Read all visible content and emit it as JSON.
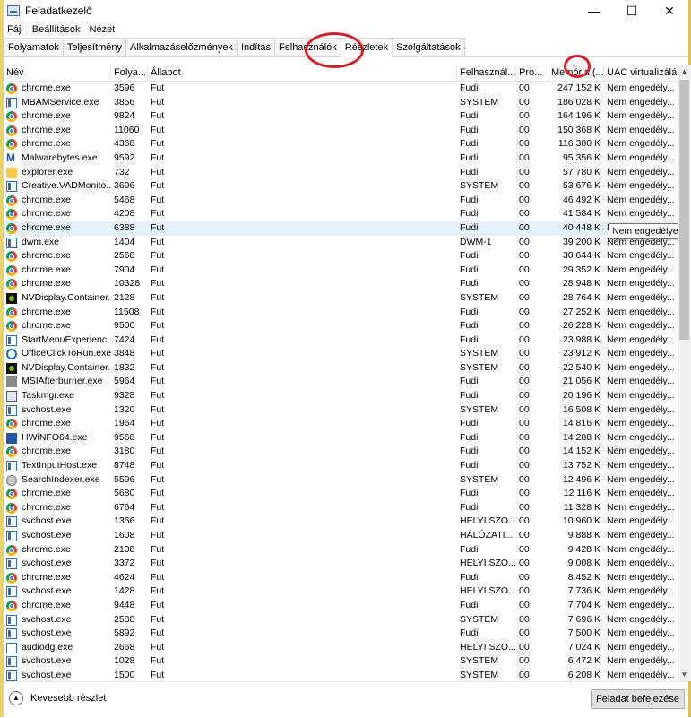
{
  "window": {
    "title": "Feladatkezelő",
    "minimize": "—",
    "maximize": "☐",
    "close": "✕"
  },
  "menu": [
    "Fájl",
    "Beállítások",
    "Nézet"
  ],
  "tabs": [
    "Folyamatok",
    "Teljesítmény",
    "Alkalmazáselőzmények",
    "Indítás",
    "Felhasználók",
    "Részletek",
    "Szolgáltatások"
  ],
  "active_tab": "Részletek",
  "columns": [
    "Név",
    "Folya...",
    "Állapot",
    "Felhasznál...",
    "Pro...",
    "Memória (...",
    "UAC virtualizálás"
  ],
  "sort_indicator": "⌄",
  "rows": [
    {
      "icon": "chrome-icon",
      "name": "chrome.exe",
      "pid": "3596",
      "status": "Fut",
      "user": "Fudi",
      "cpu": "00",
      "mem": "247 152 K",
      "uac": "Nem engedély..."
    },
    {
      "icon": "service-icon",
      "name": "MBAMService.exe",
      "pid": "3856",
      "status": "Fut",
      "user": "SYSTEM",
      "cpu": "00",
      "mem": "186 028 K",
      "uac": "Nem engedély..."
    },
    {
      "icon": "chrome-icon",
      "name": "chrome.exe",
      "pid": "9824",
      "status": "Fut",
      "user": "Fudi",
      "cpu": "00",
      "mem": "164 196 K",
      "uac": "Nem engedély..."
    },
    {
      "icon": "chrome-icon",
      "name": "chrome.exe",
      "pid": "11060",
      "status": "Fut",
      "user": "Fudi",
      "cpu": "00",
      "mem": "150 368 K",
      "uac": "Nem engedély..."
    },
    {
      "icon": "chrome-icon",
      "name": "chrome.exe",
      "pid": "4368",
      "status": "Fut",
      "user": "Fudi",
      "cpu": "00",
      "mem": "116 380 K",
      "uac": "Nem engedély..."
    },
    {
      "icon": "malwarebytes-icon",
      "name": "Malwarebytes.exe",
      "pid": "9592",
      "status": "Fut",
      "user": "Fudi",
      "cpu": "00",
      "mem": "95 356 K",
      "uac": "Nem engedély..."
    },
    {
      "icon": "folder-icon",
      "name": "explorer.exe",
      "pid": "732",
      "status": "Fut",
      "user": "Fudi",
      "cpu": "00",
      "mem": "57 780 K",
      "uac": "Nem engedély..."
    },
    {
      "icon": "service-icon",
      "name": "Creative.VADMonito...",
      "pid": "3696",
      "status": "Fut",
      "user": "SYSTEM",
      "cpu": "00",
      "mem": "53 676 K",
      "uac": "Nem engedély..."
    },
    {
      "icon": "chrome-icon",
      "name": "chrome.exe",
      "pid": "5468",
      "status": "Fut",
      "user": "Fudi",
      "cpu": "00",
      "mem": "46 492 K",
      "uac": "Nem engedély..."
    },
    {
      "icon": "chrome-icon",
      "name": "chrome.exe",
      "pid": "4208",
      "status": "Fut",
      "user": "Fudi",
      "cpu": "00",
      "mem": "41 584 K",
      "uac": "Nem engedély..."
    },
    {
      "icon": "chrome-icon",
      "name": "chrome.exe",
      "pid": "6388",
      "status": "Fut",
      "user": "Fudi",
      "cpu": "00",
      "mem": "40 448 K",
      "uac": "Nem engedély...",
      "selected": true
    },
    {
      "icon": "service-icon",
      "name": "dwm.exe",
      "pid": "1404",
      "status": "Fut",
      "user": "DWM-1",
      "cpu": "00",
      "mem": "39 200 K",
      "uac": "Nem engedély..."
    },
    {
      "icon": "chrome-icon",
      "name": "chrome.exe",
      "pid": "2568",
      "status": "Fut",
      "user": "Fudi",
      "cpu": "00",
      "mem": "30 644 K",
      "uac": "Nem engedély..."
    },
    {
      "icon": "chrome-icon",
      "name": "chrome.exe",
      "pid": "7904",
      "status": "Fut",
      "user": "Fudi",
      "cpu": "00",
      "mem": "29 352 K",
      "uac": "Nem engedély..."
    },
    {
      "icon": "chrome-icon",
      "name": "chrome.exe",
      "pid": "10328",
      "status": "Fut",
      "user": "Fudi",
      "cpu": "00",
      "mem": "28 948 K",
      "uac": "Nem engedély..."
    },
    {
      "icon": "nvidia-icon",
      "name": "NVDisplay.Container...",
      "pid": "2128",
      "status": "Fut",
      "user": "SYSTEM",
      "cpu": "00",
      "mem": "28 764 K",
      "uac": "Nem engedély..."
    },
    {
      "icon": "chrome-icon",
      "name": "chrome.exe",
      "pid": "11508",
      "status": "Fut",
      "user": "Fudi",
      "cpu": "00",
      "mem": "27 252 K",
      "uac": "Nem engedély..."
    },
    {
      "icon": "chrome-icon",
      "name": "chrome.exe",
      "pid": "9500",
      "status": "Fut",
      "user": "Fudi",
      "cpu": "00",
      "mem": "26 228 K",
      "uac": "Nem engedély..."
    },
    {
      "icon": "service-icon",
      "name": "StartMenuExperienc...",
      "pid": "7424",
      "status": "Fut",
      "user": "Fudi",
      "cpu": "00",
      "mem": "23 988 K",
      "uac": "Nem engedély..."
    },
    {
      "icon": "gear-icon",
      "name": "OfficeClickToRun.exe",
      "pid": "3848",
      "status": "Fut",
      "user": "SYSTEM",
      "cpu": "00",
      "mem": "23 912 K",
      "uac": "Nem engedély..."
    },
    {
      "icon": "nvidia-icon",
      "name": "NVDisplay.Container...",
      "pid": "1832",
      "status": "Fut",
      "user": "SYSTEM",
      "cpu": "00",
      "mem": "22 540 K",
      "uac": "Nem engedély..."
    },
    {
      "icon": "msi-icon",
      "name": "MSIAfterburner.exe",
      "pid": "5964",
      "status": "Fut",
      "user": "Fudi",
      "cpu": "00",
      "mem": "21 056 K",
      "uac": "Nem engedély..."
    },
    {
      "icon": "taskmgr-icon",
      "name": "Taskmgr.exe",
      "pid": "9328",
      "status": "Fut",
      "user": "Fudi",
      "cpu": "00",
      "mem": "20 196 K",
      "uac": "Nem engedély..."
    },
    {
      "icon": "service-icon",
      "name": "svchost.exe",
      "pid": "1320",
      "status": "Fut",
      "user": "SYSTEM",
      "cpu": "00",
      "mem": "16 508 K",
      "uac": "Nem engedély..."
    },
    {
      "icon": "chrome-icon",
      "name": "chrome.exe",
      "pid": "1964",
      "status": "Fut",
      "user": "Fudi",
      "cpu": "00",
      "mem": "14 816 K",
      "uac": "Nem engedély..."
    },
    {
      "icon": "hwinfo-icon",
      "name": "HWiNFO64.exe",
      "pid": "9568",
      "status": "Fut",
      "user": "Fudi",
      "cpu": "00",
      "mem": "14 288 K",
      "uac": "Nem engedély..."
    },
    {
      "icon": "chrome-icon",
      "name": "chrome.exe",
      "pid": "3180",
      "status": "Fut",
      "user": "Fudi",
      "cpu": "00",
      "mem": "14 152 K",
      "uac": "Nem engedély..."
    },
    {
      "icon": "service-icon",
      "name": "TextInputHost.exe",
      "pid": "8748",
      "status": "Fut",
      "user": "Fudi",
      "cpu": "00",
      "mem": "13 752 K",
      "uac": "Nem engedély..."
    },
    {
      "icon": "search-icon",
      "name": "SearchIndexer.exe",
      "pid": "5596",
      "status": "Fut",
      "user": "SYSTEM",
      "cpu": "00",
      "mem": "12 496 K",
      "uac": "Nem engedély..."
    },
    {
      "icon": "chrome-icon",
      "name": "chrome.exe",
      "pid": "5680",
      "status": "Fut",
      "user": "Fudi",
      "cpu": "00",
      "mem": "12 116 K",
      "uac": "Nem engedély..."
    },
    {
      "icon": "chrome-icon",
      "name": "chrome.exe",
      "pid": "6764",
      "status": "Fut",
      "user": "Fudi",
      "cpu": "00",
      "mem": "11 328 K",
      "uac": "Nem engedély..."
    },
    {
      "icon": "service-icon",
      "name": "svchost.exe",
      "pid": "1356",
      "status": "Fut",
      "user": "HELYI SZO...",
      "cpu": "00",
      "mem": "10 960 K",
      "uac": "Nem engedély..."
    },
    {
      "icon": "service-icon",
      "name": "svchost.exe",
      "pid": "1608",
      "status": "Fut",
      "user": "HÁLÓZATI...",
      "cpu": "00",
      "mem": "9 888 K",
      "uac": "Nem engedély..."
    },
    {
      "icon": "chrome-icon",
      "name": "chrome.exe",
      "pid": "2108",
      "status": "Fut",
      "user": "Fudi",
      "cpu": "00",
      "mem": "9 428 K",
      "uac": "Nem engedély..."
    },
    {
      "icon": "service-icon",
      "name": "svchost.exe",
      "pid": "3372",
      "status": "Fut",
      "user": "HELYI SZO...",
      "cpu": "00",
      "mem": "9 008 K",
      "uac": "Nem engedély..."
    },
    {
      "icon": "chrome-icon",
      "name": "chrome.exe",
      "pid": "4624",
      "status": "Fut",
      "user": "Fudi",
      "cpu": "00",
      "mem": "8 452 K",
      "uac": "Nem engedély..."
    },
    {
      "icon": "service-icon",
      "name": "svchost.exe",
      "pid": "1428",
      "status": "Fut",
      "user": "HELYI SZO...",
      "cpu": "00",
      "mem": "7 736 K",
      "uac": "Nem engedély..."
    },
    {
      "icon": "chrome-icon",
      "name": "chrome.exe",
      "pid": "9448",
      "status": "Fut",
      "user": "Fudi",
      "cpu": "00",
      "mem": "7 704 K",
      "uac": "Nem engedély..."
    },
    {
      "icon": "service-icon",
      "name": "svchost.exe",
      "pid": "2588",
      "status": "Fut",
      "user": "SYSTEM",
      "cpu": "00",
      "mem": "7 696 K",
      "uac": "Nem engedély..."
    },
    {
      "icon": "service-icon",
      "name": "svchost.exe",
      "pid": "5892",
      "status": "Fut",
      "user": "Fudi",
      "cpu": "00",
      "mem": "7 500 K",
      "uac": "Nem engedély..."
    },
    {
      "icon": "audio-icon",
      "name": "audiodg.exe",
      "pid": "2668",
      "status": "Fut",
      "user": "HELYI SZO...",
      "cpu": "00",
      "mem": "7 024 K",
      "uac": "Nem engedély..."
    },
    {
      "icon": "service-icon",
      "name": "svchost.exe",
      "pid": "1028",
      "status": "Fut",
      "user": "SYSTEM",
      "cpu": "00",
      "mem": "6 472 K",
      "uac": "Nem engedély..."
    },
    {
      "icon": "service-icon",
      "name": "svchost.exe",
      "pid": "1500",
      "status": "Fut",
      "user": "SYSTEM",
      "cpu": "00",
      "mem": "6 208 K",
      "uac": "Nem engedély..."
    }
  ],
  "tooltip": "Nem engedélyezett",
  "footer": {
    "fewer_details": "Kevesebb részlet",
    "end_task": "Feladat befejezése"
  },
  "annotation_color": "#d21f2b"
}
